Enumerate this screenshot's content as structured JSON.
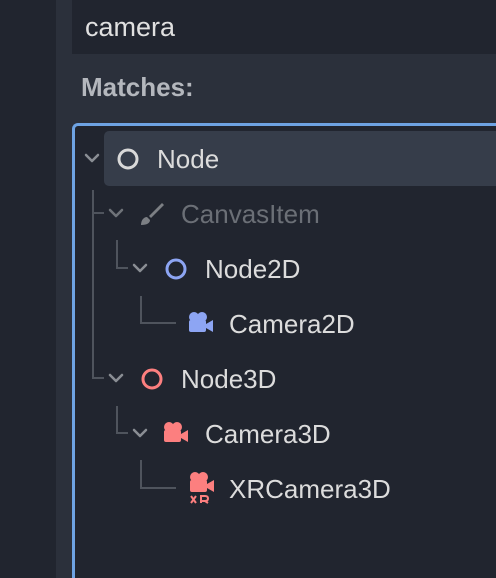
{
  "search": {
    "value": "camera"
  },
  "matches_label": "Matches:",
  "tree": {
    "items": [
      {
        "label": "Node",
        "icon": "node-circle-icon",
        "color": "#d9d9d9",
        "selected": true,
        "dim": false
      },
      {
        "label": "CanvasItem",
        "icon": "brush-icon",
        "color": "#7c7f84",
        "selected": false,
        "dim": true
      },
      {
        "label": "Node2D",
        "icon": "node2d-circle-icon",
        "color": "#8da5f3",
        "selected": false,
        "dim": false
      },
      {
        "label": "Camera2D",
        "icon": "camera2d-icon",
        "color": "#8da5f3",
        "selected": false,
        "dim": false
      },
      {
        "label": "Node3D",
        "icon": "node3d-circle-icon",
        "color": "#fc7f7f",
        "selected": false,
        "dim": false
      },
      {
        "label": "Camera3D",
        "icon": "camera3d-icon",
        "color": "#fc7f7f",
        "selected": false,
        "dim": false
      },
      {
        "label": "XRCamera3D",
        "icon": "xr-camera3d-icon",
        "color": "#fc7f7f",
        "selected": false,
        "dim": false
      }
    ]
  }
}
